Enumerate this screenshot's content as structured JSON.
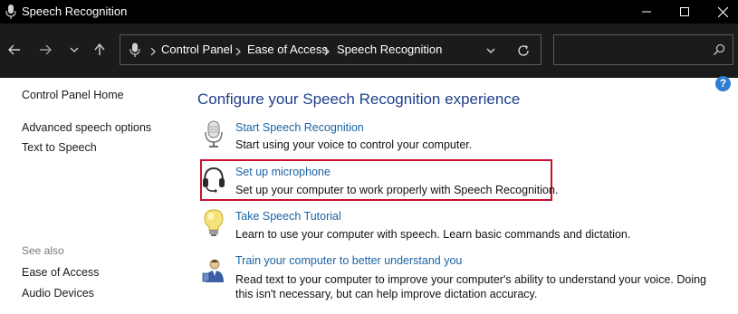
{
  "window": {
    "title": "Speech Recognition",
    "controls": [
      "minimize",
      "maximize",
      "close"
    ]
  },
  "nav": {
    "breadcrumb": [
      "Control Panel",
      "Ease of Access",
      "Speech Recognition"
    ],
    "search_placeholder": ""
  },
  "sidebar": {
    "home": "Control Panel Home",
    "items": [
      "Advanced speech options",
      "Text to Speech"
    ],
    "see_also_label": "See also",
    "see_also": [
      "Ease of Access",
      "Audio Devices"
    ]
  },
  "main": {
    "heading": "Configure your Speech Recognition experience",
    "items": [
      {
        "icon": "microphone-icon",
        "title": "Start Speech Recognition",
        "desc": [
          "Start using your voice to control your computer."
        ]
      },
      {
        "icon": "headset-icon",
        "title": "Set up microphone",
        "desc": [
          "Set up your computer to work properly with Speech Recognition."
        ],
        "highlighted": true
      },
      {
        "icon": "lightbulb-icon",
        "title": "Take Speech Tutorial",
        "desc": [
          "Learn to use your computer with speech.  Learn basic commands and dictation."
        ]
      },
      {
        "icon": "user-train-icon",
        "title": "Train your computer to better understand you",
        "desc": [
          "Read text to your computer to improve your computer's ability to understand your voice.  Doing",
          "this isn't necessary, but can help improve dictation accuracy."
        ]
      }
    ]
  },
  "colors": {
    "titlebar_bg": "#000000",
    "navbar_bg": "#1b1b1b",
    "link": "#1a64a5",
    "heading": "#1e3f8a",
    "highlight_border": "#c8102e",
    "help_icon": "#2d7dd2"
  }
}
